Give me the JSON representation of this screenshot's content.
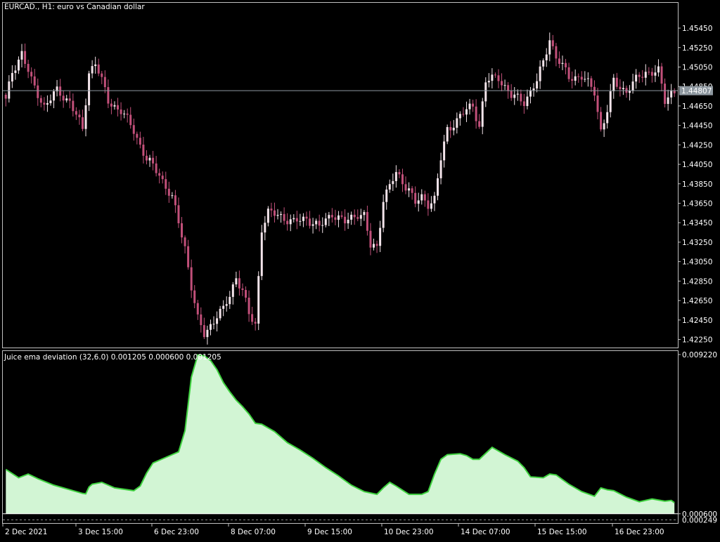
{
  "main_chart": {
    "header": "EURCAD., H1:  euro vs Canadian dollar",
    "y_ticks": [
      "1.45450",
      "1.45250",
      "1.45050",
      "1.44850",
      "1.44650",
      "1.44450",
      "1.44250",
      "1.44050",
      "1.43850",
      "1.43650",
      "1.43450",
      "1.43250",
      "1.43050",
      "1.42850",
      "1.42650",
      "1.42450",
      "1.42250"
    ],
    "current_price": "1.44807"
  },
  "indicator": {
    "header": "Juice ema deviation (32,6.0) 0.001205 0.000600 0.001205",
    "y_ticks": [
      "0.009220",
      "0.000600"
    ],
    "bottom_label": "0.000249"
  },
  "x_ticks": [
    "2 Dec 2021",
    "3 Dec 15:00",
    "6 Dec 23:00",
    "8 Dec 07:00",
    "9 Dec 15:00",
    "10 Dec 23:00",
    "14 Dec 07:00",
    "15 Dec 15:00",
    "16 Dec 23:00"
  ],
  "colors": {
    "background": "#000000",
    "candle_bear": "#c2507a",
    "candle_bull": "#f3e4ea",
    "current_price_line": "#8e98a0",
    "price_label_bg": "#8e98a0",
    "indicator_fill": "#d2f5d4",
    "indicator_line": "#3fd13f",
    "axis": "#c0c0c0",
    "text": "#ffffff"
  },
  "chart_data": [
    {
      "type": "candlestick",
      "title": "EURCAD., H1:  euro vs Canadian dollar",
      "x_labels": [
        "2 Dec 2021",
        "3 Dec 15:00",
        "6 Dec 23:00",
        "8 Dec 07:00",
        "9 Dec 15:00",
        "10 Dec 23:00",
        "14 Dec 07:00",
        "15 Dec 15:00",
        "16 Dec 23:00"
      ],
      "ylim": [
        1.4216,
        1.4571
      ],
      "current_price": 1.44807,
      "close_path": [
        [
          0,
          1.447
        ],
        [
          2,
          1.45
        ],
        [
          5,
          1.452
        ],
        [
          8,
          1.449
        ],
        [
          12,
          1.4465
        ],
        [
          16,
          1.448
        ],
        [
          20,
          1.447
        ],
        [
          24,
          1.444
        ],
        [
          26,
          1.45
        ],
        [
          28,
          1.451
        ],
        [
          32,
          1.447
        ],
        [
          36,
          1.446
        ],
        [
          40,
          1.444
        ],
        [
          44,
          1.441
        ],
        [
          48,
          1.4395
        ],
        [
          52,
          1.437
        ],
        [
          56,
          1.432
        ],
        [
          58,
          1.428
        ],
        [
          60,
          1.4245
        ],
        [
          62,
          1.423
        ],
        [
          64,
          1.424
        ],
        [
          66,
          1.425
        ],
        [
          68,
          1.4255
        ],
        [
          70,
          1.427
        ],
        [
          72,
          1.429
        ],
        [
          74,
          1.4275
        ],
        [
          76,
          1.425
        ],
        [
          78,
          1.424
        ],
        [
          80,
          1.434
        ],
        [
          82,
          1.4355
        ],
        [
          86,
          1.4352
        ],
        [
          90,
          1.4345
        ],
        [
          94,
          1.435
        ],
        [
          98,
          1.434
        ],
        [
          102,
          1.4355
        ],
        [
          106,
          1.4345
        ],
        [
          110,
          1.4355
        ],
        [
          112,
          1.4352
        ],
        [
          114,
          1.432
        ],
        [
          116,
          1.432
        ],
        [
          118,
          1.437
        ],
        [
          122,
          1.4395
        ],
        [
          126,
          1.438
        ],
        [
          128,
          1.4365
        ],
        [
          130,
          1.437
        ],
        [
          132,
          1.4365
        ],
        [
          134,
          1.437
        ],
        [
          136,
          1.441
        ],
        [
          138,
          1.444
        ],
        [
          142,
          1.4455
        ],
        [
          146,
          1.4465
        ],
        [
          148,
          1.4445
        ],
        [
          150,
          1.449
        ],
        [
          154,
          1.4495
        ],
        [
          158,
          1.4475
        ],
        [
          162,
          1.447
        ],
        [
          166,
          1.449
        ],
        [
          168,
          1.451
        ],
        [
          170,
          1.4535
        ],
        [
          172,
          1.4515
        ],
        [
          176,
          1.4495
        ],
        [
          180,
          1.4495
        ],
        [
          184,
          1.448
        ],
        [
          186,
          1.444
        ],
        [
          188,
          1.446
        ],
        [
          190,
          1.449
        ],
        [
          194,
          1.448
        ],
        [
          198,
          1.4495
        ],
        [
          200,
          1.45
        ],
        [
          204,
          1.45
        ],
        [
          206,
          1.447
        ],
        [
          208,
          1.448
        ],
        [
          209,
          1.4481
        ]
      ]
    },
    {
      "type": "area",
      "title": "Juice ema deviation (32,6.0) 0.001205 0.000600 0.001205",
      "x_labels": [
        "2 Dec 2021",
        "3 Dec 15:00",
        "6 Dec 23:00",
        "8 Dec 07:00",
        "9 Dec 15:00",
        "10 Dec 23:00",
        "14 Dec 07:00",
        "15 Dec 15:00",
        "16 Dec 23:00"
      ],
      "ylim": [
        0.000249,
        0.00922
      ],
      "level": 0.0006,
      "x": [
        0,
        4,
        7,
        10,
        15,
        20,
        24,
        25,
        26,
        27,
        30,
        34,
        40,
        42,
        44,
        46,
        50,
        54,
        56,
        58,
        60,
        62,
        64,
        66,
        68,
        70,
        72,
        74,
        76,
        78,
        80,
        84,
        88,
        92,
        96,
        100,
        104,
        108,
        112,
        116,
        118,
        120,
        122,
        126,
        130,
        132,
        134,
        136,
        138,
        142,
        144,
        146,
        148,
        152,
        156,
        160,
        162,
        164,
        168,
        170,
        172,
        176,
        180,
        184,
        186,
        188,
        190,
        194,
        198,
        202,
        206,
        208,
        209
      ],
      "y": [
        0.003,
        0.00255,
        0.00275,
        0.0025,
        0.00215,
        0.0019,
        0.0017,
        0.00168,
        0.00205,
        0.0022,
        0.0023,
        0.002,
        0.00185,
        0.0021,
        0.0028,
        0.00335,
        0.00365,
        0.00395,
        0.0051,
        0.008,
        0.0092,
        0.00915,
        0.0089,
        0.0084,
        0.0077,
        0.0072,
        0.00675,
        0.0064,
        0.006,
        0.0055,
        0.00545,
        0.00505,
        0.00445,
        0.00405,
        0.0036,
        0.0031,
        0.00265,
        0.00215,
        0.0018,
        0.00165,
        0.002,
        0.0023,
        0.0021,
        0.00165,
        0.00165,
        0.0018,
        0.00275,
        0.00355,
        0.0038,
        0.00385,
        0.00375,
        0.00355,
        0.00355,
        0.0042,
        0.0038,
        0.00345,
        0.0031,
        0.0026,
        0.00255,
        0.00275,
        0.0027,
        0.0022,
        0.0018,
        0.00155,
        0.002,
        0.0019,
        0.00185,
        0.0015,
        0.00125,
        0.0014,
        0.00128,
        0.00132,
        0.0012
      ]
    }
  ]
}
